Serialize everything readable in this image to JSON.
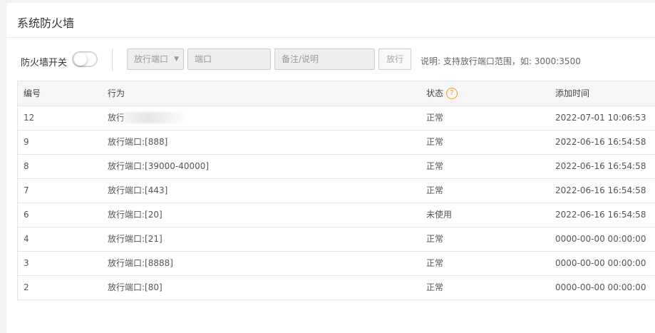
{
  "page": {
    "title": "系统防火墙"
  },
  "toolbar": {
    "switch_label": "防火墙开关",
    "switch_on": false,
    "select_value": "放行端口",
    "port_placeholder": "端口",
    "note_placeholder": "备注/说明",
    "release_button": "放行",
    "hint": "说明: 支持放行端口范围，如: 3000:3500"
  },
  "table": {
    "headers": {
      "id": "编号",
      "action": "行为",
      "status": "状态",
      "time": "添加时间"
    },
    "status_help_icon": "?",
    "rows": [
      {
        "id": "12",
        "action": "放行",
        "status": "正常",
        "time": "2022-07-01 10:06:53"
      },
      {
        "id": "9",
        "action": "放行端口:[888]",
        "status": "正常",
        "time": "2022-06-16 16:54:58"
      },
      {
        "id": "8",
        "action": "放行端口:[39000-40000]",
        "status": "正常",
        "time": "2022-06-16 16:54:58"
      },
      {
        "id": "7",
        "action": "放行端口:[443]",
        "status": "正常",
        "time": "2022-06-16 16:54:58"
      },
      {
        "id": "6",
        "action": "放行端口:[20]",
        "status": "未使用",
        "time": "2022-06-16 16:54:58"
      },
      {
        "id": "4",
        "action": "放行端口:[21]",
        "status": "正常",
        "time": "0000-00-00 00:00:00"
      },
      {
        "id": "3",
        "action": "放行端口:[8888]",
        "status": "正常",
        "time": "0000-00-00 00:00:00"
      },
      {
        "id": "2",
        "action": "放行端口:[80]",
        "status": "正常",
        "time": "0000-00-00 00:00:00"
      }
    ]
  }
}
